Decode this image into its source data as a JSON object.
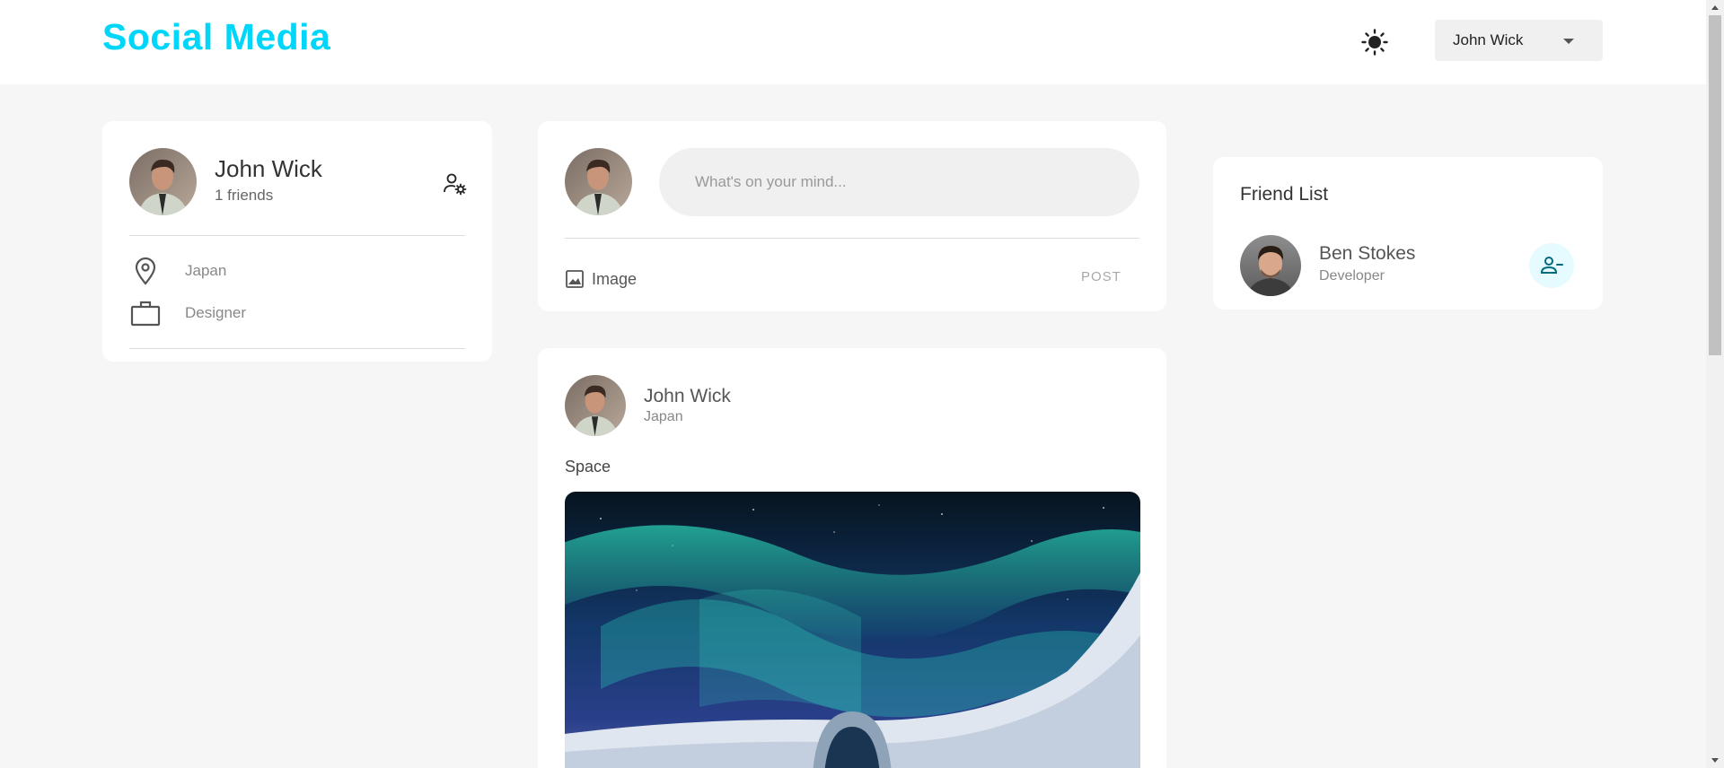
{
  "navbar": {
    "brand": "Social Media",
    "theme_icon": "sun-icon",
    "user_select": {
      "value": "John Wick",
      "options": [
        "John Wick"
      ]
    }
  },
  "user_widget": {
    "name": "John Wick",
    "friends": "1 friends",
    "location": "Japan",
    "occupation": "Designer",
    "icons": {
      "manage": "manage-account-icon",
      "location": "location-pin-icon",
      "occupation": "briefcase-icon"
    }
  },
  "create_post": {
    "placeholder": "What's on your mind...",
    "image_label": "Image",
    "post_label": "POST"
  },
  "post": {
    "author": "John Wick",
    "location": "Japan",
    "description": "Space"
  },
  "friend_list": {
    "title": "Friend List",
    "friends": [
      {
        "name": "Ben Stokes",
        "occupation": "Developer"
      }
    ]
  },
  "colors": {
    "brand": "#00d5fa",
    "background": "#f6f6f6",
    "card": "#ffffff",
    "accent_light": "#e6fbff",
    "accent_dark": "#006b7d"
  }
}
